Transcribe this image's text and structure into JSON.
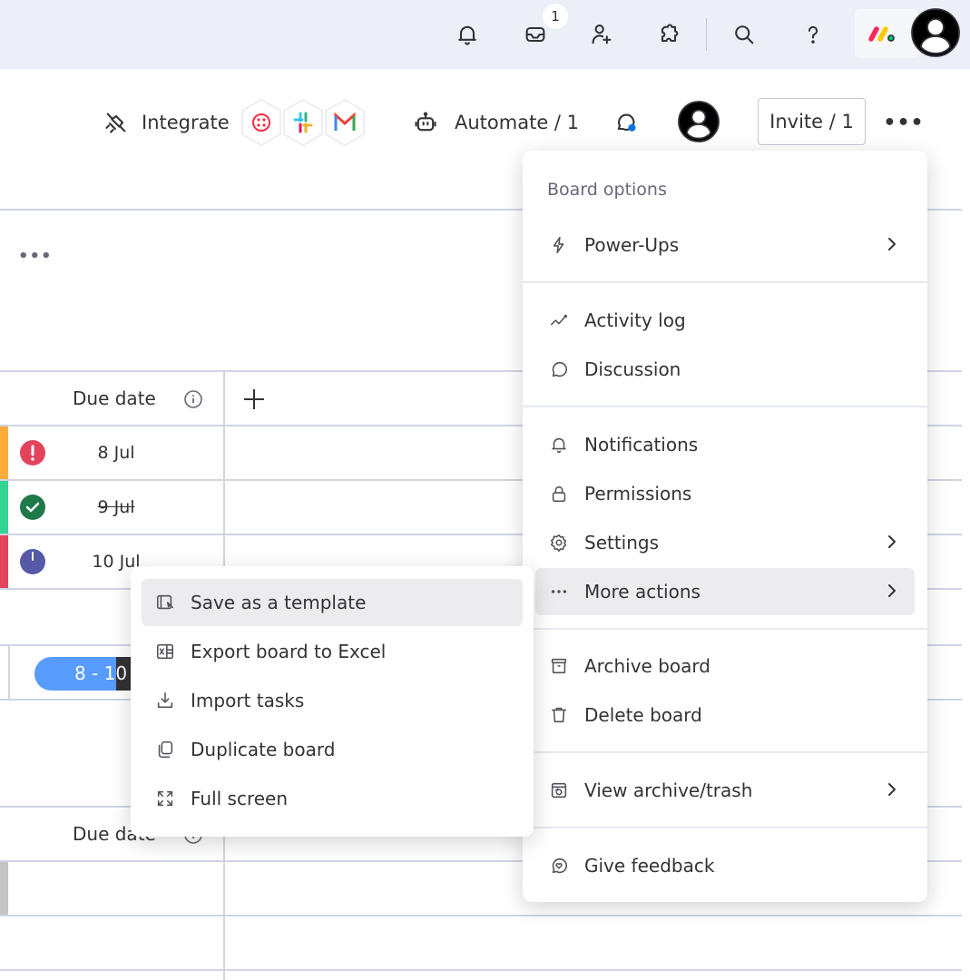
{
  "topbar": {
    "icons": [
      "bell-icon",
      "inbox-icon",
      "invite-members-icon",
      "apps-puzzle-icon",
      "search-icon",
      "help-icon"
    ],
    "inbox_badge": "1",
    "brand_colors": [
      "#fb275d",
      "#ffcb00",
      "#00ca72"
    ]
  },
  "board_header": {
    "integrate_label": "Integrate",
    "integration_apps": [
      "twilio",
      "slack",
      "gmail"
    ],
    "automate_label": "Automate / 1",
    "invite_label": "Invite / 1",
    "more_label": "•••"
  },
  "table": {
    "group_menu": "•••",
    "columns": [
      {
        "title": "Due date"
      }
    ],
    "add_column_label": "+",
    "rows": [
      {
        "status": "overdue",
        "status_color": "#e2445c",
        "bar_color": "#fdab3d",
        "due_date": "8 Jul",
        "strikethrough": false
      },
      {
        "status": "done",
        "status_color": "#1f7a4a",
        "bar_color": "#33d391",
        "due_date": "9 Jul",
        "strikethrough": true
      },
      {
        "status": "in-progress",
        "status_color": "#5559a8",
        "bar_color": "#e2445c",
        "due_date": "10 Jul",
        "strikethrough": false
      }
    ],
    "summary_timeline": "8 - 10",
    "summary_colors": [
      "#579bfc",
      "#333333"
    ],
    "second_group_column": "Due date"
  },
  "board_options_menu": {
    "title": "Board options",
    "sections": [
      [
        {
          "label": "Power-Ups",
          "icon": "lightning-icon",
          "submenu": true
        }
      ],
      [
        {
          "label": "Activity log",
          "icon": "activity-icon",
          "submenu": false
        },
        {
          "label": "Discussion",
          "icon": "chat-bubble-icon",
          "submenu": false
        }
      ],
      [
        {
          "label": "Notifications",
          "icon": "bell-icon",
          "submenu": false
        },
        {
          "label": "Permissions",
          "icon": "lock-icon",
          "submenu": false
        },
        {
          "label": "Settings",
          "icon": "gear-icon",
          "submenu": true
        },
        {
          "label": "More actions",
          "icon": "ellipsis-icon",
          "submenu": true,
          "highlighted": true
        }
      ],
      [
        {
          "label": "Archive board",
          "icon": "archive-icon",
          "submenu": false
        },
        {
          "label": "Delete board",
          "icon": "trash-icon",
          "submenu": false
        }
      ],
      [
        {
          "label": "View archive/trash",
          "icon": "archive-restore-icon",
          "submenu": true
        }
      ],
      [
        {
          "label": "Give feedback",
          "icon": "feedback-icon",
          "submenu": false
        }
      ]
    ]
  },
  "more_actions_menu": {
    "items": [
      {
        "label": "Save as a template",
        "icon": "template-icon",
        "highlighted": true
      },
      {
        "label": "Export board to Excel",
        "icon": "excel-icon"
      },
      {
        "label": "Import tasks",
        "icon": "import-icon"
      },
      {
        "label": "Duplicate board",
        "icon": "duplicate-icon"
      },
      {
        "label": "Full screen",
        "icon": "fullscreen-icon"
      }
    ]
  }
}
